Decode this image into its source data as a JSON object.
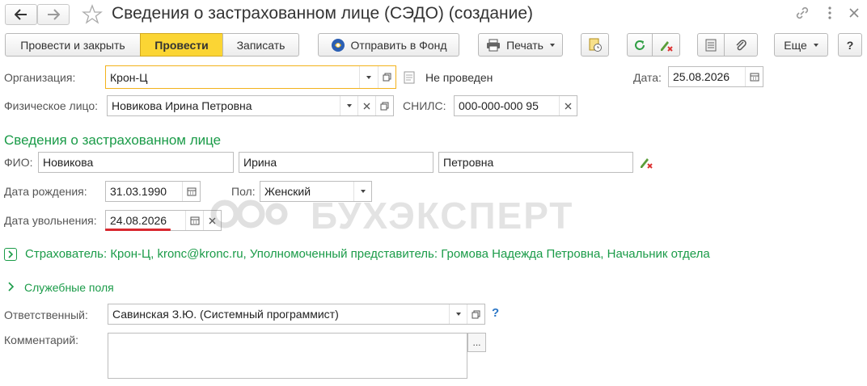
{
  "window": {
    "title": "Сведения о застрахованном лице (СЭДО) (создание)"
  },
  "toolbar": {
    "post_and_close": "Провести и закрыть",
    "post": "Провести",
    "save": "Записать",
    "send_to_fund": "Отправить в Фонд",
    "print": "Печать",
    "more": "Еще",
    "help": "?"
  },
  "form": {
    "organization_label": "Организация:",
    "organization_value": "Крон-Ц",
    "status_text": "Не проведен",
    "date_label": "Дата:",
    "date_value": "25.08.2026",
    "person_label": "Физическое лицо:",
    "person_value": "Новикова Ирина Петровна",
    "snils_label": "СНИЛС:",
    "snils_value": "000-000-000 95"
  },
  "insured": {
    "section_title": "Сведения о застрахованном лице",
    "fio_label": "ФИО:",
    "last_name": "Новикова",
    "first_name": "Ирина",
    "middle_name": "Петровна",
    "birth_label": "Дата рождения:",
    "birth_value": "31.03.1990",
    "gender_label": "Пол:",
    "gender_value": "Женский",
    "dismissal_label": "Дата увольнения:",
    "dismissal_value": "24.08.2026"
  },
  "watermark": "БУХЭКСПЕРТ",
  "policyholder": {
    "text": "Страхователь: Крон-Ц, kronc@kronc.ru, Уполномоченный представитель: Громова Надежда Петровна, Начальник отдела"
  },
  "service": {
    "title": "Служебные поля"
  },
  "responsible": {
    "label": "Ответственный:",
    "value": "Савинская З.Ю. (Системный программист)",
    "help": "?"
  },
  "comment": {
    "label": "Комментарий:",
    "value": "",
    "more": "..."
  },
  "colors": {
    "accent_yellow": "#fbd534",
    "green_text": "#1a9b48",
    "underline_red": "#d9282f",
    "focus_border": "#f3b21b"
  }
}
